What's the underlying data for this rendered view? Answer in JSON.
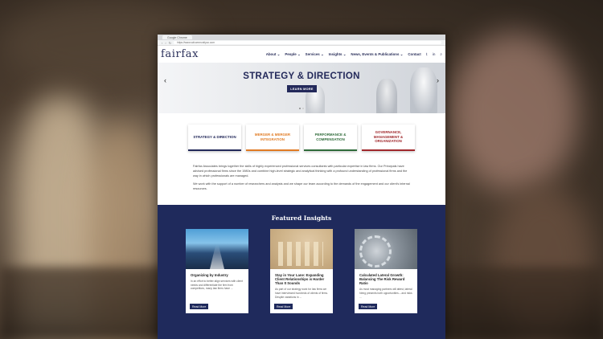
{
  "browser": {
    "tab_title": "Google Chrome",
    "url": "https://www.scfcommunityco.com"
  },
  "site": {
    "logo": "fairfax",
    "nav": [
      {
        "label": "About",
        "caret": "⌄"
      },
      {
        "label": "People",
        "caret": "⌄"
      },
      {
        "label": "Services",
        "caret": "⌄"
      },
      {
        "label": "Insights",
        "caret": "⌄"
      },
      {
        "label": "News, Events & Publications",
        "caret": "⌄"
      },
      {
        "label": "Contact",
        "caret": ""
      }
    ],
    "social": [
      "twitter-icon",
      "linkedin-icon",
      "search-icon"
    ]
  },
  "hero": {
    "title": "STRATEGY & DIRECTION",
    "button": "LEARN MORE"
  },
  "services": [
    {
      "label": "STRATEGY & DIRECTION",
      "color": "#23295a"
    },
    {
      "label": "MERGER & MERGER INTEGRATION",
      "color": "#e07b24"
    },
    {
      "label": "PERFORMANCE & COMPENSATION",
      "color": "#2f6b3a"
    },
    {
      "label": "GOVERNANCE, MANAGEMENT & ORGANIZATION",
      "color": "#a0282c"
    }
  ],
  "intro": {
    "p1": "Fairfax Associates brings together the skills of highly experienced professional services consultants with particular expertise in law firms. Our Principals have advised professional firms since the 1980s and combine high-level strategic and analytical thinking with a profound understanding of professional firms and the way in which professionals are managed.",
    "p2": "We work with the support of a number of researchers and analysts and we shape our team according to the demands of the engagement and our client's internal resources."
  },
  "featured": {
    "heading": "Featured Insights",
    "cards": [
      {
        "title": "Organizing by Industry",
        "desc": "In an effort to better align services with client needs and differentiate the firm from competitors, many law firms have ...",
        "button": "Read More"
      },
      {
        "title": "Stay in Your Lane: Expanding Client Relationships is Harder Than It Sounds",
        "desc": "As part of our strategy work for law firms we have interviewed hundreds of clients of firms. Despite variations in ...",
        "button": "Read More"
      },
      {
        "title": "Calculated Lateral Growth: Balancing The Risk Reward Ratio",
        "desc": "As most managing partners will attest, lateral hiring presents both opportunities – and risks ...",
        "button": "Read More"
      }
    ]
  },
  "colors": {
    "brand_navy": "#23295a",
    "featured_bg": "#1f2a5c"
  }
}
